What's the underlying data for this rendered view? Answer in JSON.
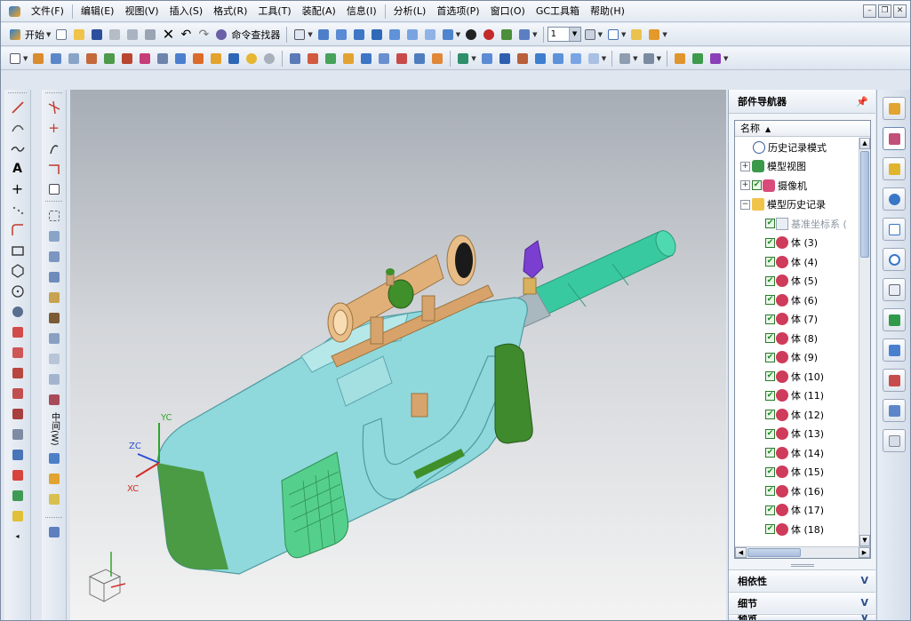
{
  "menu": [
    "文件(F)",
    "编辑(E)",
    "视图(V)",
    "插入(S)",
    "格式(R)",
    "工具(T)",
    "装配(A)",
    "信息(I)",
    "分析(L)",
    "首选项(P)",
    "窗口(O)",
    "GC工具箱",
    "帮助(H)"
  ],
  "window_controls": [
    "–",
    "❐",
    "✕"
  ],
  "toolbar": {
    "start_label": "开始",
    "command_finder_label": "命令查找器",
    "layer_value": "1"
  },
  "left_toolbar": {
    "text_tool": "A",
    "section_label": "中间(W)"
  },
  "navigator": {
    "title": "部件导航器",
    "column_name": "名称",
    "sort_indicator": "▲",
    "tree": [
      {
        "label": "历史记录模式",
        "indent": 1,
        "icon": "clock",
        "toggle": "",
        "check": false,
        "dim": false
      },
      {
        "label": "模型视图",
        "indent": 0,
        "icon": "view",
        "toggle": "+",
        "check": false,
        "dim": false
      },
      {
        "label": "摄像机",
        "indent": 0,
        "icon": "camera",
        "toggle": "+",
        "check": true,
        "dim": false
      },
      {
        "label": "模型历史记录",
        "indent": 0,
        "icon": "folder",
        "toggle": "−",
        "check": false,
        "dim": false
      },
      {
        "label": "基准坐标系 (",
        "indent": 2,
        "icon": "csys",
        "toggle": "",
        "check": true,
        "dim": true
      },
      {
        "label": "体 (3)",
        "indent": 2,
        "icon": "body",
        "toggle": "",
        "check": true,
        "dim": false
      },
      {
        "label": "体 (4)",
        "indent": 2,
        "icon": "body",
        "toggle": "",
        "check": true,
        "dim": false
      },
      {
        "label": "体 (5)",
        "indent": 2,
        "icon": "body",
        "toggle": "",
        "check": true,
        "dim": false
      },
      {
        "label": "体 (6)",
        "indent": 2,
        "icon": "body",
        "toggle": "",
        "check": true,
        "dim": false
      },
      {
        "label": "体 (7)",
        "indent": 2,
        "icon": "body",
        "toggle": "",
        "check": true,
        "dim": false
      },
      {
        "label": "体 (8)",
        "indent": 2,
        "icon": "body",
        "toggle": "",
        "check": true,
        "dim": false
      },
      {
        "label": "体 (9)",
        "indent": 2,
        "icon": "body",
        "toggle": "",
        "check": true,
        "dim": false
      },
      {
        "label": "体 (10)",
        "indent": 2,
        "icon": "body",
        "toggle": "",
        "check": true,
        "dim": false
      },
      {
        "label": "体 (11)",
        "indent": 2,
        "icon": "body",
        "toggle": "",
        "check": true,
        "dim": false
      },
      {
        "label": "体 (12)",
        "indent": 2,
        "icon": "body",
        "toggle": "",
        "check": true,
        "dim": false
      },
      {
        "label": "体 (13)",
        "indent": 2,
        "icon": "body",
        "toggle": "",
        "check": true,
        "dim": false
      },
      {
        "label": "体 (14)",
        "indent": 2,
        "icon": "body",
        "toggle": "",
        "check": true,
        "dim": false
      },
      {
        "label": "体 (15)",
        "indent": 2,
        "icon": "body",
        "toggle": "",
        "check": true,
        "dim": false
      },
      {
        "label": "体 (16)",
        "indent": 2,
        "icon": "body",
        "toggle": "",
        "check": true,
        "dim": false
      },
      {
        "label": "体 (17)",
        "indent": 2,
        "icon": "body",
        "toggle": "",
        "check": true,
        "dim": false
      },
      {
        "label": "体 (18)",
        "indent": 2,
        "icon": "body",
        "toggle": "",
        "check": true,
        "dim": false
      }
    ],
    "panels": [
      {
        "label": "相依性",
        "chevron": "V"
      },
      {
        "label": "细节",
        "chevron": "V"
      },
      {
        "label": "预览",
        "chevron": "V"
      }
    ]
  },
  "viewport": {
    "axis_labels": {
      "yc": "YC",
      "zc": "ZC",
      "xc": "XC"
    }
  },
  "colors": {
    "body_cyan": "#8fd9dc",
    "body_green": "#3f8f2a",
    "barrel_green": "#39c9a0",
    "scope_tan": "#e1b078",
    "accent_purple": "#7a3fd1"
  }
}
